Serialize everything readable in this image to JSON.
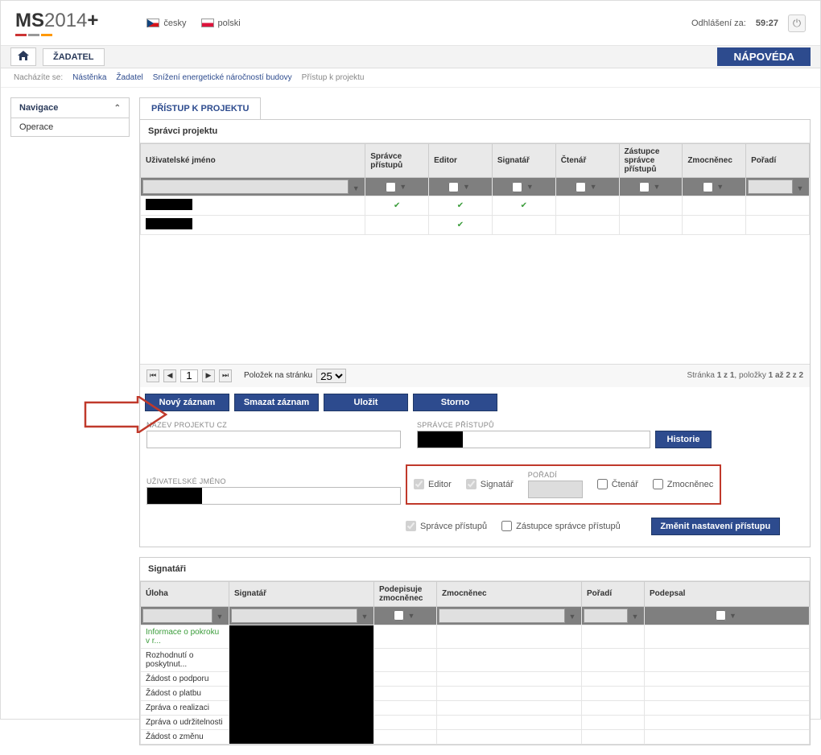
{
  "header": {
    "logo": {
      "pre": "MS",
      "year": "2014",
      "plus": "+"
    },
    "langs": [
      {
        "code": "cz",
        "label": "česky"
      },
      {
        "code": "pl",
        "label": "polski"
      }
    ],
    "logout_label": "Odhlášení za:",
    "timer": "59:27"
  },
  "nav": {
    "zadatel": "ŽADATEL",
    "help": "NÁPOVÉDA"
  },
  "breadcrumb": {
    "label": "Nacházíte se:",
    "items": [
      "Nástěnka",
      "Žadatel",
      "Snížení energetické náročností budovy",
      "Přístup k projektu"
    ]
  },
  "sidebar": {
    "title": "Navigace",
    "items": [
      "Operace"
    ]
  },
  "tab_title": "PŘÍSTUP K PROJEKTU",
  "spravci": {
    "title": "Správci projektu",
    "cols": [
      "Uživatelské jméno",
      "Správce přístupů",
      "Editor",
      "Signatář",
      "Čtenář",
      "Zástupce správce přístupů",
      "Zmocněnec",
      "Pořadí"
    ],
    "rows": [
      {
        "spravce": true,
        "editor": true,
        "signatar": true
      },
      {
        "spravce": false,
        "editor": true,
        "signatar": false
      }
    ]
  },
  "pager": {
    "page": "1",
    "per_page_label": "Položek na stránku",
    "per_page": "25",
    "info_prefix": "Stránka",
    "info_page": "1 z 1",
    "info_mid": ", položky",
    "info_items": "1 až 2 z 2"
  },
  "buttons": {
    "novy": "Nový záznam",
    "smazat": "Smazat záznam",
    "ulozit": "Uložit",
    "storno": "Storno",
    "historie": "Historie",
    "zmenit": "Změnit nastavení přístupu"
  },
  "form": {
    "nazev_label": "NÁZEV PROJEKTU CZ",
    "spravce_label": "SPRÁVCE PŘÍSTUPŮ",
    "uzivatel_label": "UŽIVATELSKÉ JMÉNO",
    "poradi_label": "POŘADÍ",
    "roles": {
      "editor": "Editor",
      "signatar": "Signatář",
      "ctenar": "Čtenář",
      "zmocnenec": "Zmoсněnec",
      "spravce": "Správce přístupů",
      "zastupce": "Zástupce správce přístupů"
    }
  },
  "signatari": {
    "title": "Signatáři",
    "cols": [
      "Úloha",
      "Signatář",
      "Podepisuje zmocněnec",
      "Zmocněnec",
      "Pořadí",
      "Podepsal"
    ],
    "rows": [
      "Informace o pokroku v r...",
      "Rozhodnutí o poskytnut...",
      "Žádost o podporu",
      "Žádost o platbu",
      "Zpráva o realizaci",
      "Zpráva o udržitelnosti",
      "Žádost o změnu"
    ]
  }
}
